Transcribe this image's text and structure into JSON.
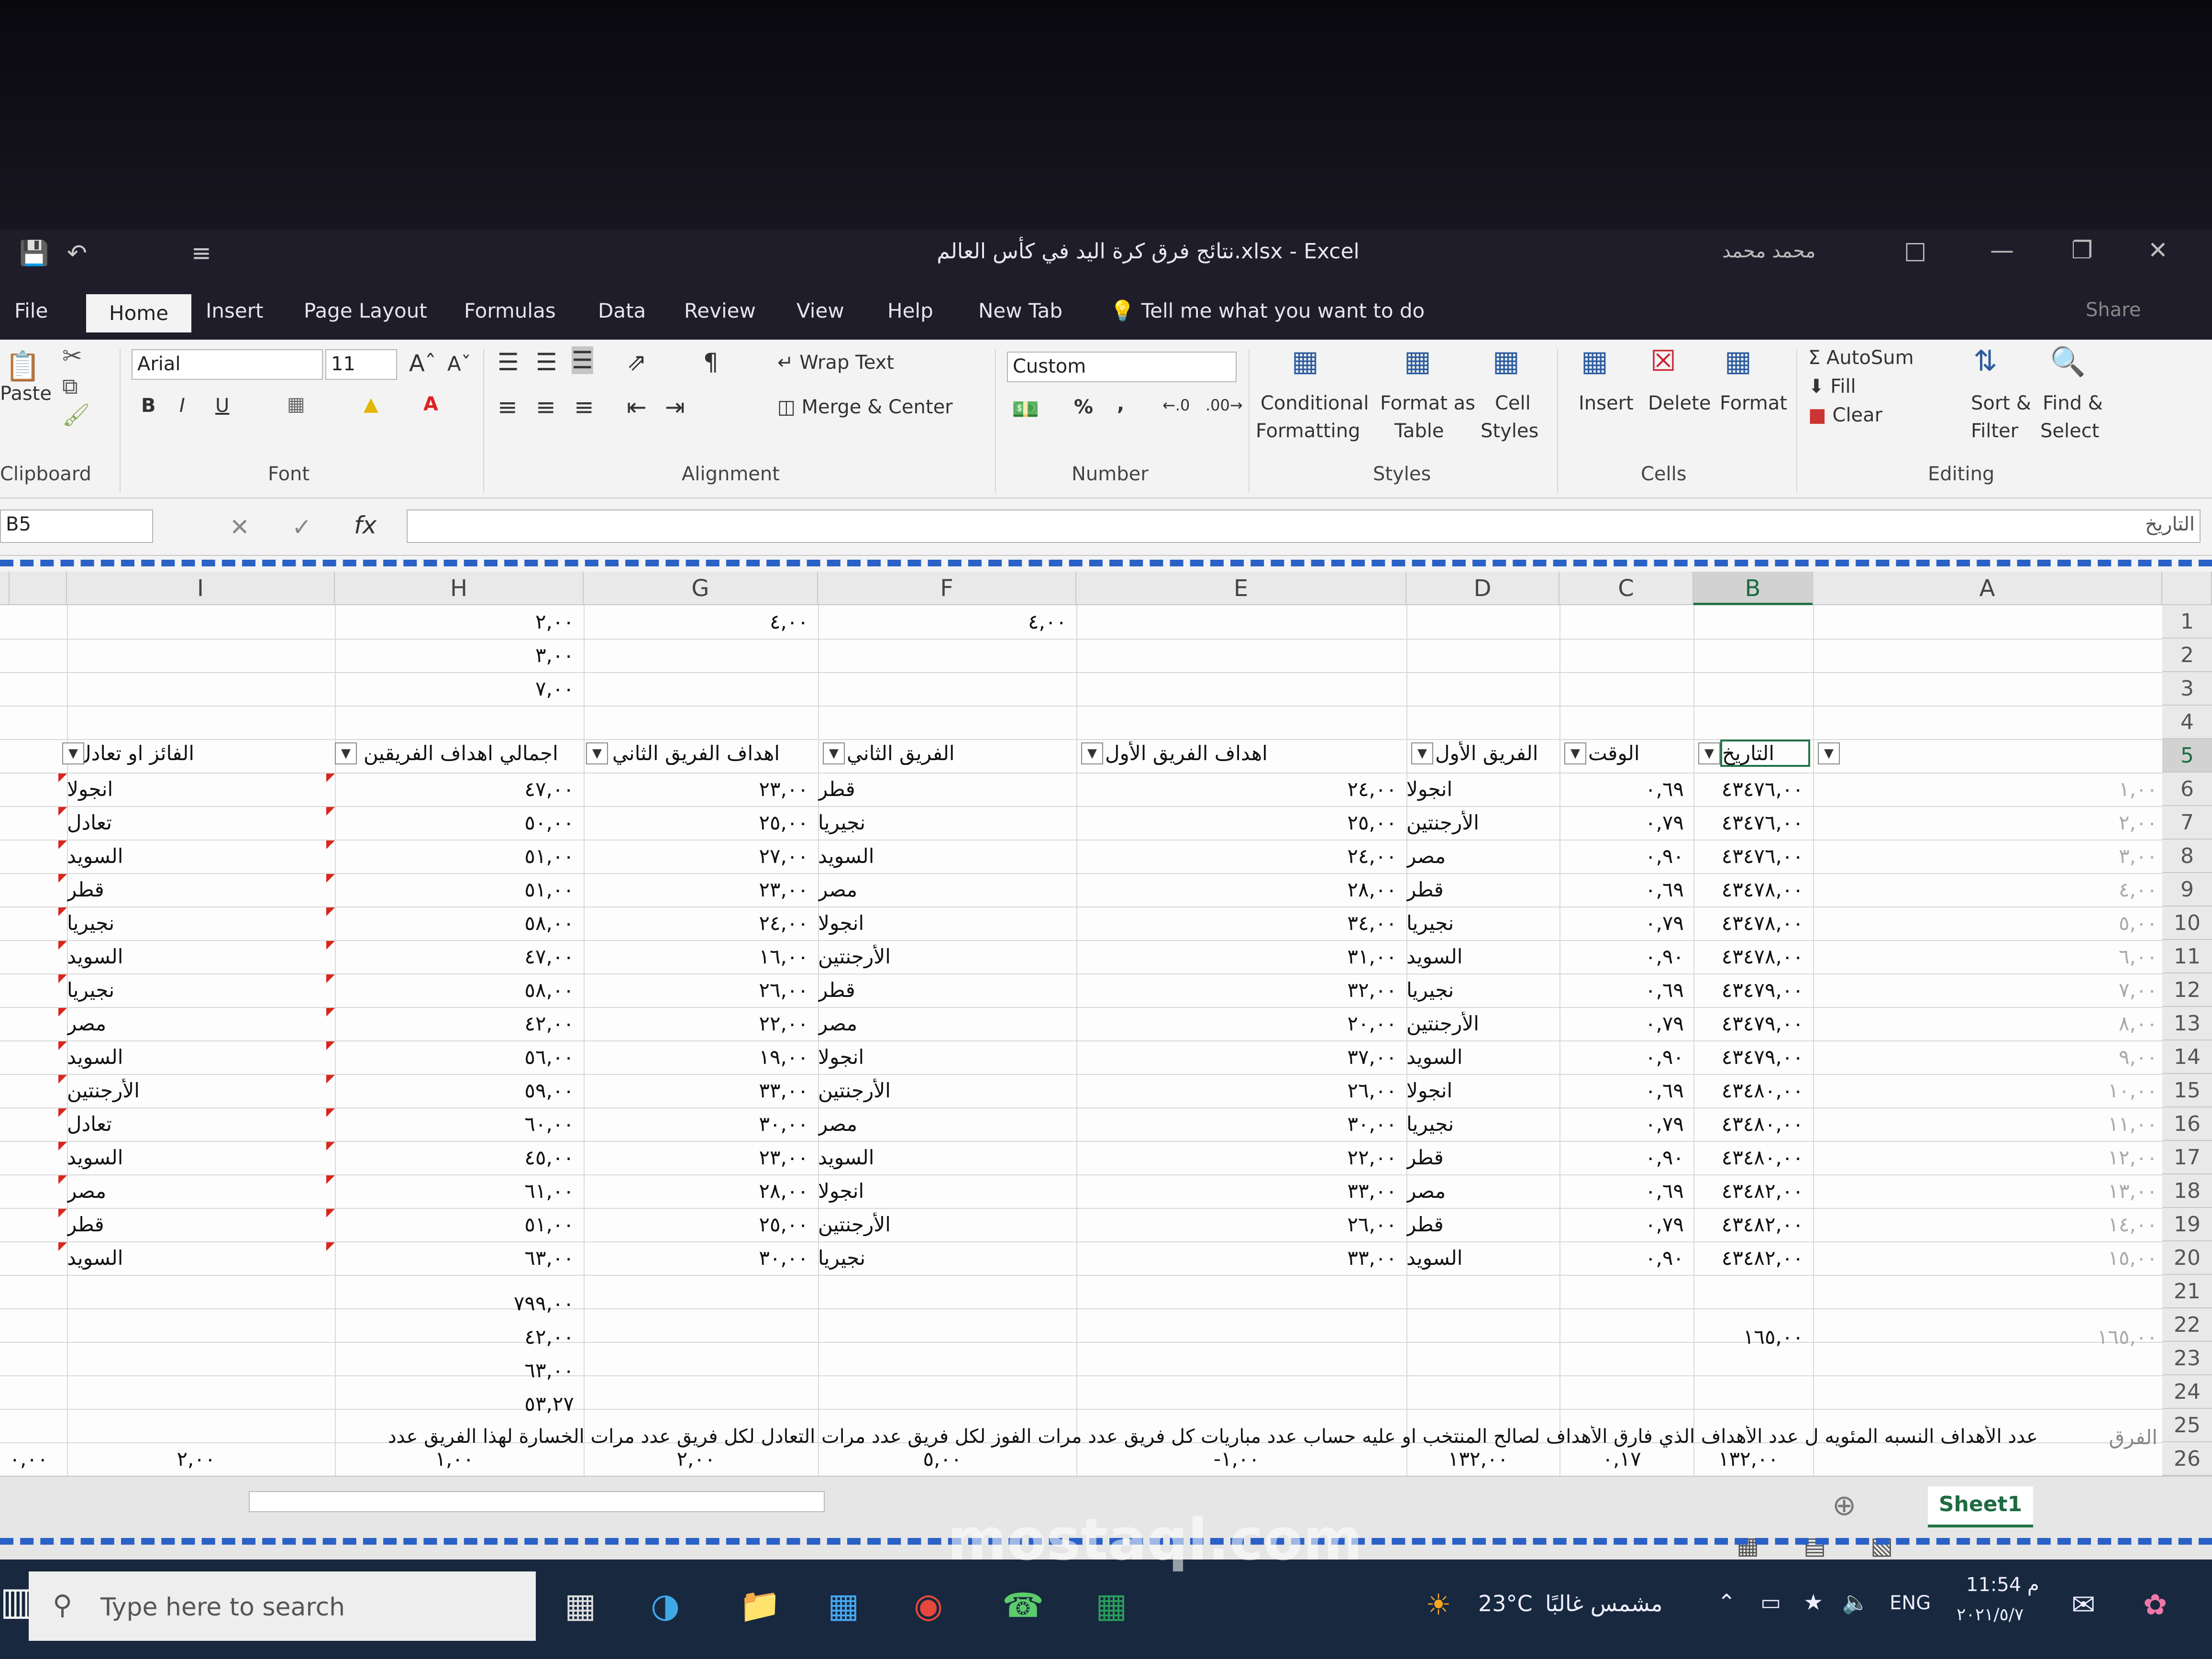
{
  "title_bar": {
    "title": "نتائج فرق كرة اليد في كأس العالم.xlsx  -  Excel",
    "user": "محمد محمد"
  },
  "tabs": [
    "File",
    "Home",
    "Insert",
    "Page Layout",
    "Formulas",
    "Data",
    "Review",
    "View",
    "Help",
    "New Tab"
  ],
  "tell_me": "Tell me what you want to do",
  "share": "Share",
  "ribbon": {
    "paste": "Paste",
    "clipboard": "Clipboard",
    "font_name": "Arial",
    "font_size": "11",
    "font_group": "Font",
    "bold": "B",
    "italic": "I",
    "underline": "U",
    "wrap_text": "Wrap Text",
    "merge_center": "Merge & Center",
    "alignment_group": "Alignment",
    "number_format": "Custom",
    "number_group": "Number",
    "percent": "%",
    "comma": ",",
    "conditional_1": "Conditional",
    "conditional_2": "Formatting",
    "format_table_1": "Format as",
    "format_table_2": "Table",
    "cell_styles_1": "Cell",
    "cell_styles_2": "Styles",
    "styles_group": "Styles",
    "insert": "Insert",
    "delete": "Delete",
    "format": "Format",
    "cells_group": "Cells",
    "autosum": "AutoSum",
    "fill": "Fill",
    "clear": "Clear",
    "sort_1": "Sort &",
    "sort_2": "Filter",
    "find_1": "Find &",
    "find_2": "Select",
    "editing_group": "Editing"
  },
  "formula_bar": {
    "name_box": "B5",
    "content": "التاريخ"
  },
  "columns": [
    "I",
    "H",
    "G",
    "F",
    "E",
    "D",
    "C",
    "B",
    "A"
  ],
  "rows": [
    "1",
    "2",
    "3",
    "4",
    "5",
    "6",
    "7",
    "8",
    "9",
    "10",
    "11",
    "12",
    "13",
    "14",
    "15",
    "16",
    "17",
    "18",
    "19",
    "20",
    "21",
    "22",
    "23",
    "24",
    "25",
    "26"
  ],
  "top_values": {
    "h1": "٢,٠٠",
    "h2": "٣,٠٠",
    "h3": "٧,٠٠",
    "g1": "٤,٠٠",
    "f1": "٤,٠٠"
  },
  "headers": {
    "b": "التاريخ",
    "c": "الوقت",
    "d": "الفريق الأول",
    "e": "اهداف الفريق الأول",
    "f": "الفريق الثاني",
    "g": "اهداف الفريق الثاني",
    "h": "اجمالي اهداف الفريقين",
    "i": "الفائز او تعادل"
  },
  "data_rows": [
    {
      "a": "١,٠٠",
      "b": "٤٣٤٧٦,٠٠",
      "c": "٠,٦٩",
      "d": "انجولا",
      "e": "٢٤,٠٠",
      "f": "قطر",
      "g": "٢٣,٠٠",
      "h": "٤٧,٠٠",
      "i": "انجولا"
    },
    {
      "a": "٢,٠٠",
      "b": "٤٣٤٧٦,٠٠",
      "c": "٠,٧٩",
      "d": "الأرجنتين",
      "e": "٢٥,٠٠",
      "f": "نجيريا",
      "g": "٢٥,٠٠",
      "h": "٥٠,٠٠",
      "i": "تعادل"
    },
    {
      "a": "٣,٠٠",
      "b": "٤٣٤٧٦,٠٠",
      "c": "٠,٩٠",
      "d": "مصر",
      "e": "٢٤,٠٠",
      "f": "السويد",
      "g": "٢٧,٠٠",
      "h": "٥١,٠٠",
      "i": "السويد"
    },
    {
      "a": "٤,٠٠",
      "b": "٤٣٤٧٨,٠٠",
      "c": "٠,٦٩",
      "d": "قطر",
      "e": "٢٨,٠٠",
      "f": "مصر",
      "g": "٢٣,٠٠",
      "h": "٥١,٠٠",
      "i": "قطر"
    },
    {
      "a": "٥,٠٠",
      "b": "٤٣٤٧٨,٠٠",
      "c": "٠,٧٩",
      "d": "نجيريا",
      "e": "٣٤,٠٠",
      "f": "انجولا",
      "g": "٢٤,٠٠",
      "h": "٥٨,٠٠",
      "i": "نجيريا"
    },
    {
      "a": "٦,٠٠",
      "b": "٤٣٤٧٨,٠٠",
      "c": "٠,٩٠",
      "d": "السويد",
      "e": "٣١,٠٠",
      "f": "الأرجنتين",
      "g": "١٦,٠٠",
      "h": "٤٧,٠٠",
      "i": "السويد"
    },
    {
      "a": "٧,٠٠",
      "b": "٤٣٤٧٩,٠٠",
      "c": "٠,٦٩",
      "d": "نجيريا",
      "e": "٣٢,٠٠",
      "f": "قطر",
      "g": "٢٦,٠٠",
      "h": "٥٨,٠٠",
      "i": "نجيريا"
    },
    {
      "a": "٨,٠٠",
      "b": "٤٣٤٧٩,٠٠",
      "c": "٠,٧٩",
      "d": "الأرجنتين",
      "e": "٢٠,٠٠",
      "f": "مصر",
      "g": "٢٢,٠٠",
      "h": "٤٢,٠٠",
      "i": "مصر"
    },
    {
      "a": "٩,٠٠",
      "b": "٤٣٤٧٩,٠٠",
      "c": "٠,٩٠",
      "d": "السويد",
      "e": "٣٧,٠٠",
      "f": "انجولا",
      "g": "١٩,٠٠",
      "h": "٥٦,٠٠",
      "i": "السويد"
    },
    {
      "a": "١٠,٠٠",
      "b": "٤٣٤٨٠,٠٠",
      "c": "٠,٦٩",
      "d": "انجولا",
      "e": "٢٦,٠٠",
      "f": "الأرجنتين",
      "g": "٣٣,٠٠",
      "h": "٥٩,٠٠",
      "i": "الأرجنتين"
    },
    {
      "a": "١١,٠٠",
      "b": "٤٣٤٨٠,٠٠",
      "c": "٠,٧٩",
      "d": "نجيريا",
      "e": "٣٠,٠٠",
      "f": "مصر",
      "g": "٣٠,٠٠",
      "h": "٦٠,٠٠",
      "i": "تعادل"
    },
    {
      "a": "١٢,٠٠",
      "b": "٤٣٤٨٠,٠٠",
      "c": "٠,٩٠",
      "d": "قطر",
      "e": "٢٢,٠٠",
      "f": "السويد",
      "g": "٢٣,٠٠",
      "h": "٤٥,٠٠",
      "i": "السويد"
    },
    {
      "a": "١٣,٠٠",
      "b": "٤٣٤٨٢,٠٠",
      "c": "٠,٦٩",
      "d": "مصر",
      "e": "٣٣,٠٠",
      "f": "انجولا",
      "g": "٢٨,٠٠",
      "h": "٦١,٠٠",
      "i": "مصر"
    },
    {
      "a": "١٤,٠٠",
      "b": "٤٣٤٨٢,٠٠",
      "c": "٠,٧٩",
      "d": "قطر",
      "e": "٢٦,٠٠",
      "f": "الأرجنتين",
      "g": "٢٥,٠٠",
      "h": "٥١,٠٠",
      "i": "قطر"
    },
    {
      "a": "١٥,٠٠",
      "b": "٤٣٤٨٢,٠٠",
      "c": "٠,٩٠",
      "d": "السويد",
      "e": "٣٣,٠٠",
      "f": "نجيريا",
      "g": "٣٠,٠٠",
      "h": "٦٣,٠٠",
      "i": "السويد"
    }
  ],
  "summary": {
    "h21": "٧٩٩,٠٠",
    "h22": "٤٢,٠٠",
    "h23": "٦٣,٠٠",
    "h24": "٥٣,٢٧",
    "b22": "١٦٥,٠٠",
    "a22": "١٦٥,٠٠"
  },
  "row25": "عدد الأهداف  النسبه المئويه ل  عدد الأهداف الذي  فارق الأهداف لصالح المنتخب او عليه   حساب عدد مباريات كل فريق   عدد مرات الفوز لكل فريق   عدد مرات التعادل لكل فريق   عدد مرات الخسارة لهذا الفريق   عدد",
  "row25_a": "الفرق",
  "row26": [
    "١٣٢,٠٠",
    "٠,١٧",
    "١٣٢,٠٠",
    "-١,٠٠",
    "٥,٠٠",
    "٢,٠٠",
    "١,٠٠",
    "٢,٠٠",
    "٠,٠٠"
  ],
  "sheet_tab": "Sheet1",
  "taskbar": {
    "search": "Type here to search",
    "weather": "23°C",
    "weather_text": "مشمس غالبًا",
    "lang": "ENG",
    "time": "11:54 م",
    "date": "٢٠٢١/٥/٧"
  },
  "watermark": "mostaql.com"
}
